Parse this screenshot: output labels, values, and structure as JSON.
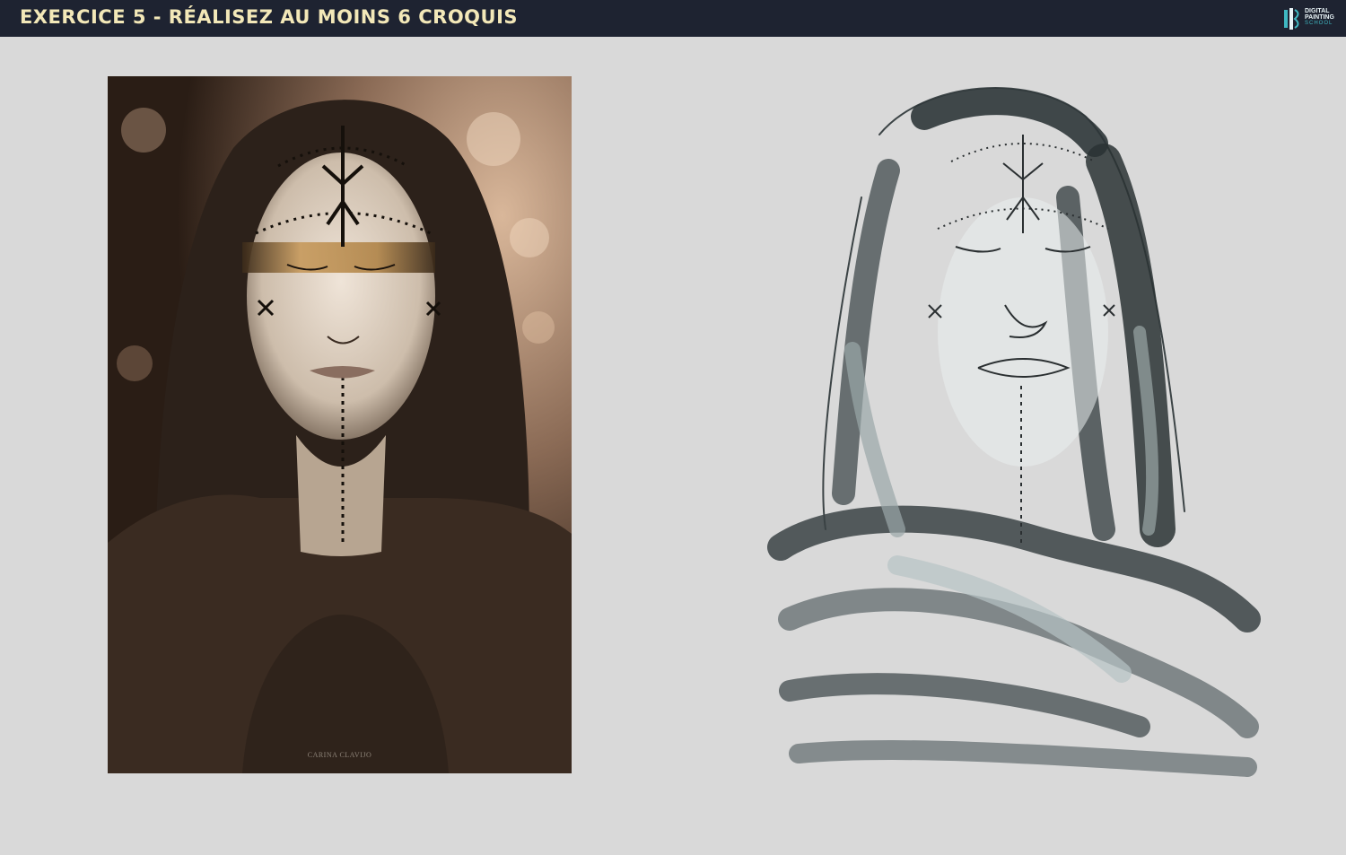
{
  "header": {
    "title": "Exercice 5 - Réalisez au moins 6 croquis",
    "logo": {
      "line1": "DIGITAL",
      "line2": "PAINTING",
      "line3": "SCHOOL"
    }
  },
  "reference_photo": {
    "credit": "CARINA CLAVIJO"
  },
  "colors": {
    "header_bg": "#1e2331",
    "title": "#f3e8b8",
    "canvas_bg": "#d9d9d9",
    "logo_accent": "#3fb8c2"
  }
}
